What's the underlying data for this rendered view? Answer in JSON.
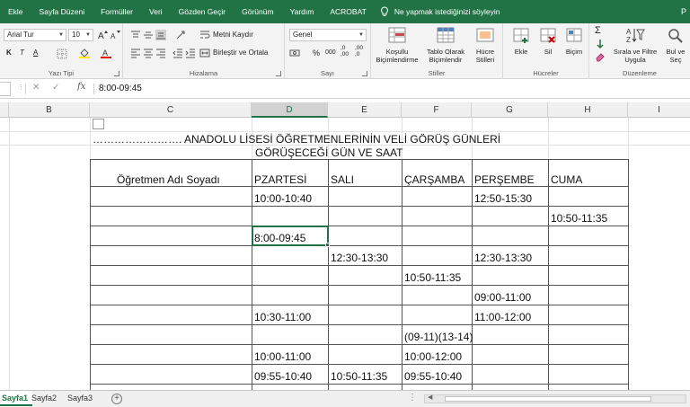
{
  "ribbon_tabs": [
    "Ekle",
    "Sayfa Düzeni",
    "Formüller",
    "Veri",
    "Gözden Geçir",
    "Görünüm",
    "Yardım",
    "ACROBAT"
  ],
  "tell_me": "Ne yapmak istediğinizi söyleyin",
  "user_initial": "P",
  "font": {
    "name": "Arial Tur",
    "size": "10",
    "bold": "K",
    "italic": "T",
    "underline": "A"
  },
  "groups": {
    "font_label": "Yazı Tipi",
    "align_label": "Hizalama",
    "number_label": "Sayı",
    "styles_label": "Stiller",
    "cells_label": "Hücreler",
    "editing_label": "Düzenleme"
  },
  "align": {
    "wrap": "Metni Kaydır",
    "merge": "Birleştir ve Ortala"
  },
  "number": {
    "format": "Genel",
    "percent": "%",
    "thousands": "000",
    "inc_dec": ",0\n,00",
    "dec_dec": ",00\n,0"
  },
  "styles": {
    "cond": [
      "Koşullu",
      "Biçimlendirme"
    ],
    "table": [
      "Tablo Olarak",
      "Biçimlendir"
    ],
    "cell": [
      "Hücre",
      "Stilleri"
    ]
  },
  "cells": {
    "insert": "Ekle",
    "delete": "Sil",
    "format": "Biçim"
  },
  "editing": {
    "sort": [
      "Sırala ve Filtre",
      "Uygula"
    ],
    "find": [
      "Bul ve",
      "Seç"
    ]
  },
  "formula_bar": {
    "value": "8:00-09:45",
    "fx": "fx"
  },
  "columns": [
    "B",
    "C",
    "D",
    "E",
    "F",
    "G",
    "H",
    "I"
  ],
  "sheet": {
    "title1": "……………………. ANADOLU LİSESİ ÖĞRETMENLERİNİN VELİ GÖRÜŞ GÜNLERİ",
    "title2": "GÖRÜŞECEĞİ GÜN VE SAAT",
    "headers": {
      "teacher": "Öğretmen Adı Soyadı",
      "mon": "PZARTESİ",
      "tue": "SALI",
      "wed": "ÇARŞAMBA",
      "thu": "PERŞEMBE",
      "fri": "CUMA"
    },
    "rows": [
      {
        "d": "10:00-10:40",
        "e": "",
        "f": "",
        "g": "12:50-15:30",
        "h": ""
      },
      {
        "d": "",
        "e": "",
        "f": "",
        "g": "",
        "h": "10:50-11:35"
      },
      {
        "d": "8:00-09:45",
        "e": "",
        "f": "",
        "g": "",
        "h": ""
      },
      {
        "d": "",
        "e": "12:30-13:30",
        "f": "",
        "g": "12:30-13:30",
        "h": ""
      },
      {
        "d": "",
        "e": "",
        "f": "10:50-11:35",
        "g": "",
        "h": ""
      },
      {
        "d": "",
        "e": "",
        "f": "",
        "g": "09:00-11:00",
        "h": ""
      },
      {
        "d": "10:30-11:00",
        "e": "",
        "f": "",
        "g": "11:00-12:00",
        "h": ""
      },
      {
        "d": "",
        "e": "",
        "f": "(09-11)(13-14)",
        "g": "",
        "h": ""
      },
      {
        "d": "10:00-11:00",
        "e": "",
        "f": "10:00-12:00",
        "g": "",
        "h": ""
      },
      {
        "d": "09:55-10:40",
        "e": "10:50-11:35",
        "f": "09:55-10:40",
        "g": "",
        "h": ""
      }
    ]
  },
  "sheet_tabs": [
    "Sayfa1",
    "Sayfa2",
    "Sayfa3"
  ],
  "add_sheet": "+",
  "colors": {
    "accent": "#217346"
  }
}
